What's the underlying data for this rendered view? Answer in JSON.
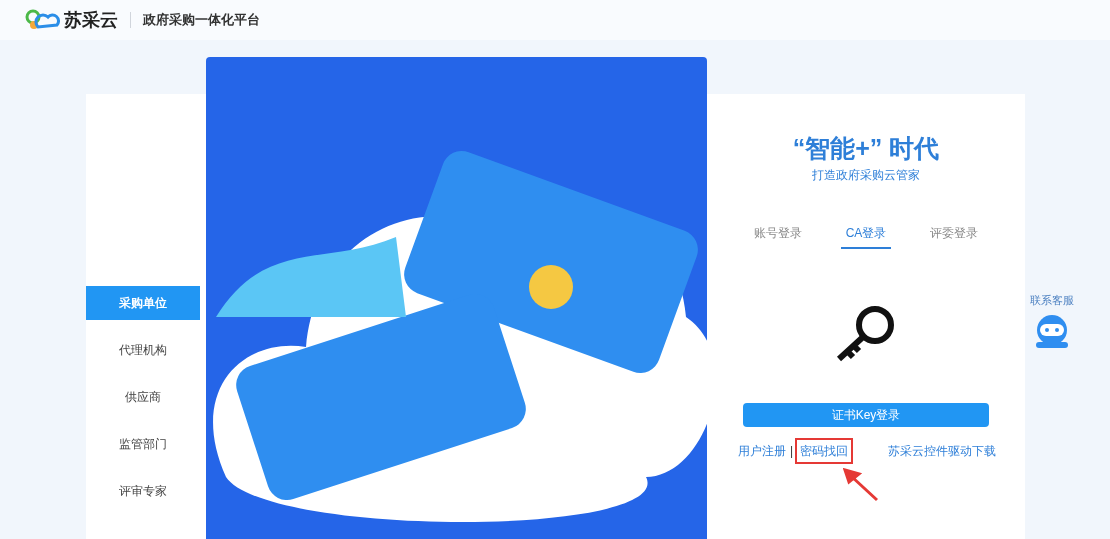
{
  "header": {
    "logo_text": "苏采云",
    "platform_title": "政府采购一体化平台"
  },
  "sidebar": {
    "items": [
      {
        "label": "采购单位",
        "selected": true
      },
      {
        "label": "代理机构",
        "selected": false
      },
      {
        "label": "供应商",
        "selected": false
      },
      {
        "label": "监管部门",
        "selected": false
      },
      {
        "label": "评审专家",
        "selected": false
      }
    ]
  },
  "login": {
    "headline": "“智能+” 时代",
    "subtitle": "打造政府采购云管家",
    "tabs": [
      {
        "label": "账号登录",
        "selected": false
      },
      {
        "label": "CA登录",
        "selected": true
      },
      {
        "label": "评委登录",
        "selected": false
      }
    ],
    "submit_button": "证书Key登录",
    "links": [
      {
        "label": "用户注册",
        "highlighted": false
      },
      {
        "label": "|",
        "kind": "separator"
      },
      {
        "label": "密码找回",
        "highlighted": true
      }
    ],
    "download_link": "苏采云控件驱动下载"
  },
  "customer_service": {
    "label": "联系客服"
  }
}
